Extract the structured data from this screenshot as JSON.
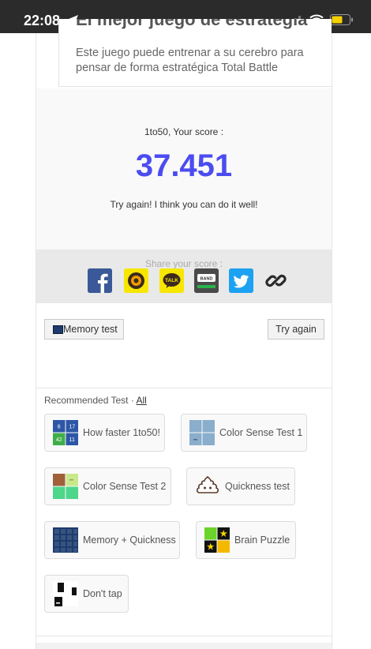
{
  "status_bar": {
    "time": "22:08"
  },
  "ad": {
    "title": "El mejor juego de estrategia",
    "description": "Este juego puede entrenar a su cerebro para pensar de forma estratégica Total Battle"
  },
  "result": {
    "label": "1to50, Your score :",
    "score": "37.451",
    "message": "Try again! I think you can do it well!"
  },
  "share": {
    "label": "Share your score :",
    "icons": [
      "facebook-icon",
      "kakaostory-icon",
      "kakaotalk-icon",
      "band-icon",
      "twitter-icon",
      "link-icon"
    ],
    "kakaotalk_text": "TALK",
    "band_text": "BAND"
  },
  "actions": {
    "memory_test": "Memory test",
    "try_again": "Try again"
  },
  "recommended": {
    "title": "Recommended Test · ",
    "all_link": "All",
    "items": [
      {
        "label": "How faster 1to50!",
        "thumb_numbers": [
          "6",
          "17",
          "42",
          "11"
        ]
      },
      {
        "label": "Color Sense Test 1"
      },
      {
        "label": "Color Sense Test 2"
      },
      {
        "label": "Quickness test"
      },
      {
        "label": "Memory + Quickness"
      },
      {
        "label": "Brain Puzzle"
      },
      {
        "label": "Don't tap"
      }
    ]
  },
  "colors": {
    "score": "#4b4cf0",
    "status_bar": "#2b2b2b",
    "battery": "#f5d000"
  }
}
